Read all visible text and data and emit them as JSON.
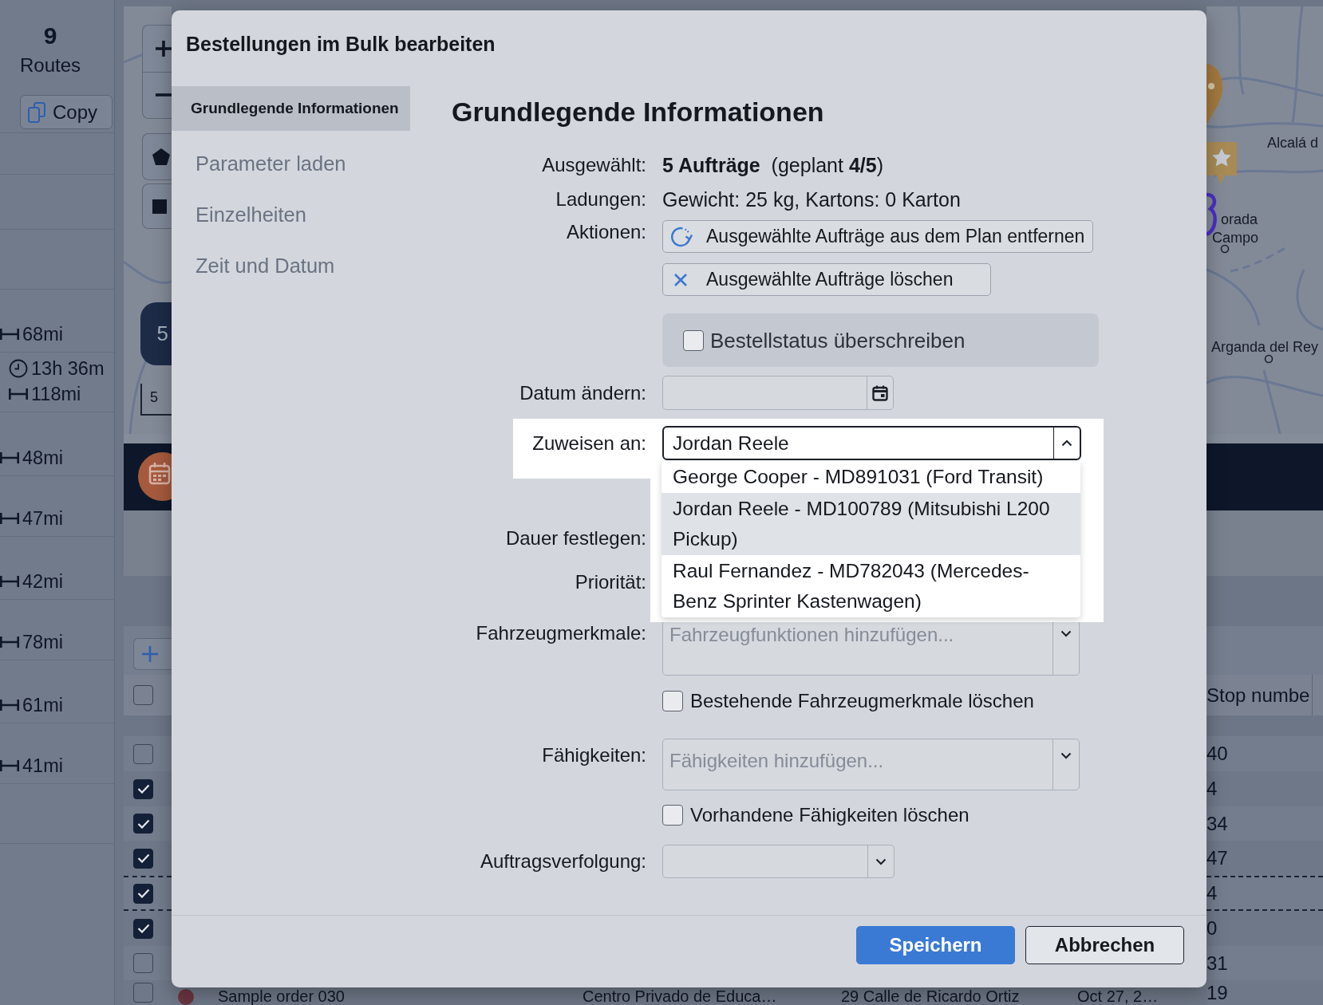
{
  "routes_panel": {
    "count": "9",
    "label": "Routes",
    "copy_button": "Copy",
    "routes": [
      {
        "distance": "68mi"
      },
      {
        "duration": "13h 36m",
        "distance": "118mi"
      },
      {
        "distance": "48mi"
      },
      {
        "distance": "47mi"
      },
      {
        "distance": "42mi"
      },
      {
        "distance": "78mi"
      },
      {
        "distance": "61mi"
      },
      {
        "distance": "41mi"
      }
    ]
  },
  "map": {
    "cluster_count": "5",
    "scale": "5",
    "labels": [
      "Alcalá d",
      "orada",
      "Campo",
      "Arganda del Rey"
    ]
  },
  "orders_table": {
    "select_all": {
      "checked": false
    },
    "columns": [
      "Stop numbe"
    ],
    "rows": [
      {
        "checked": false,
        "outlined": false,
        "stop_number": "40"
      },
      {
        "checked": true,
        "outlined": false,
        "stop_number": "4"
      },
      {
        "checked": true,
        "outlined": false,
        "stop_number": "34"
      },
      {
        "checked": true,
        "outlined": false,
        "stop_number": "47"
      },
      {
        "checked": true,
        "outlined": true,
        "stop_number": "4"
      },
      {
        "checked": true,
        "outlined": false,
        "stop_number": "0"
      },
      {
        "checked": false,
        "outlined": false,
        "stop_number": "31"
      },
      {
        "checked": false,
        "outlined": false,
        "name": "Sample order 030",
        "color": "#6a3440",
        "location": "Centro Privado de Educa…",
        "address": "29 Calle de Ricardo Ortiz",
        "date": "Oct 27, 2…",
        "stop_number": "19"
      }
    ]
  },
  "dialog": {
    "title": "Bestellungen im Bulk bearbeiten",
    "sidebar": [
      {
        "label": "Grundlegende Informationen",
        "selected": true
      },
      {
        "label": "Parameter laden",
        "selected": false
      },
      {
        "label": "Einzelheiten",
        "selected": false
      },
      {
        "label": "Zeit und Datum",
        "selected": false
      }
    ],
    "heading": "Grundlegende Informationen",
    "selected_orders": {
      "label": "Ausgewählt:",
      "value": "**5 Aufträge**  (geplant **4/5**)"
    },
    "loads": {
      "label": "Ladungen:",
      "value": "Gewicht: 25 kg, Kartons: 0 Karton"
    },
    "actions": {
      "label": "Aktionen:",
      "buttons": [
        {
          "kind": "unplan",
          "label": "Ausgewählte Aufträge aus dem Plan entfernen"
        },
        {
          "kind": "delete",
          "label": "Ausgewählte Aufträge löschen"
        }
      ]
    },
    "override_status": {
      "label": "Bestellstatus überschreiben",
      "checked": false
    },
    "change_date": {
      "label": "Datum ändern:"
    },
    "assign_to": {
      "label": "Zuweisen an:",
      "value": "Jordan Reele",
      "highlighted": true,
      "expanded": true,
      "options": [
        {
          "label": "George Cooper - MD891031 (Ford Transit)",
          "selected": false
        },
        {
          "label": "Jordan Reele - MD100789 (Mitsubishi L200 Pickup)",
          "selected": true
        },
        {
          "label": "Raul Fernandez - MD782043 (Mercedes-Benz Sprinter Kastenwagen)",
          "selected": false
        }
      ]
    },
    "set_duration": {
      "label": "Dauer festlegen:"
    },
    "priority": {
      "label": "Priorität:"
    },
    "vehicle_features": {
      "label": "Fahrzeugmerkmale:",
      "placeholder": "Fahrzeugfunktionen hinzufügen...",
      "clear_existing": {
        "label": "Bestehende Fahrzeugmerkmale löschen",
        "checked": false
      }
    },
    "skills": {
      "label": "Fähigkeiten:",
      "placeholder": "Fähigkeiten hinzufügen...",
      "clear_existing": {
        "label": "Vorhandene Fähigkeiten löschen",
        "checked": false
      }
    },
    "order_tracking": {
      "label": "Auftragsverfolgung:"
    },
    "buttons": [
      {
        "kind": "primary",
        "label": "Speichern"
      },
      {
        "kind": "secondary",
        "label": "Abbrechen"
      }
    ]
  }
}
